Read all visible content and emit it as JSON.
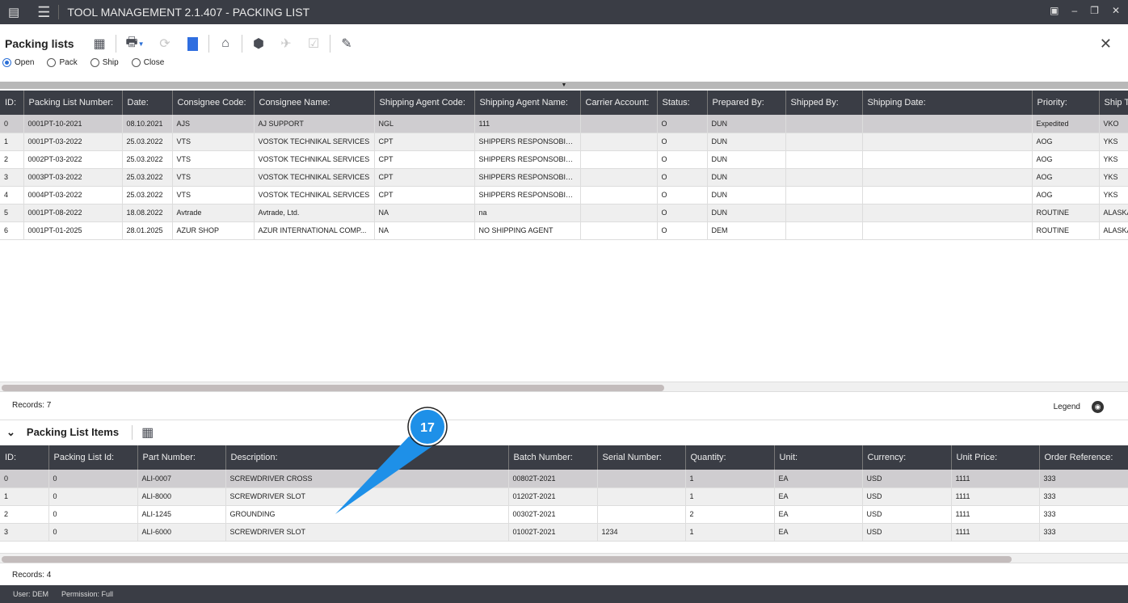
{
  "app": {
    "title": "TOOL MANAGEMENT 2.1.407 - PACKING LIST"
  },
  "toolbar": {
    "title": "Packing lists",
    "icons": [
      "grid-export-icon",
      "printer-icon",
      "refresh-icon",
      "document-icon",
      "warehouse-icon",
      "box-icon",
      "plane-icon",
      "approve-doc-icon",
      "clipboard-edit-icon"
    ]
  },
  "filters": [
    {
      "label": "Open",
      "selected": true
    },
    {
      "label": "Pack",
      "selected": false
    },
    {
      "label": "Ship",
      "selected": false
    },
    {
      "label": "Close",
      "selected": false
    }
  ],
  "packing_lists": {
    "columns": [
      "ID:",
      "Packing List Number:",
      "Date:",
      "Consignee Code:",
      "Consignee Name:",
      "Shipping Agent Code:",
      "Shipping Agent Name:",
      "Carrier Account:",
      "Status:",
      "Prepared By:",
      "Shipped By:",
      "Shipping Date:",
      "Priority:",
      "Ship To:"
    ],
    "rows": [
      [
        "0",
        "0001PT-10-2021",
        "08.10.2021",
        "AJS",
        "AJ SUPPORT",
        "NGL",
        "111",
        "",
        "O",
        "DUN",
        "",
        "",
        "Expedited",
        "VKO"
      ],
      [
        "1",
        "0001PT-03-2022",
        "25.03.2022",
        "VTS",
        "VOSTOK TECHNIKAL SERVICES",
        "CPT",
        "SHIPPERS RESPONSOBILITY",
        "",
        "O",
        "DUN",
        "",
        "",
        "AOG",
        "YKS"
      ],
      [
        "2",
        "0002PT-03-2022",
        "25.03.2022",
        "VTS",
        "VOSTOK TECHNIKAL SERVICES",
        "CPT",
        "SHIPPERS RESPONSOBILITY",
        "",
        "O",
        "DUN",
        "",
        "",
        "AOG",
        "YKS"
      ],
      [
        "3",
        "0003PT-03-2022",
        "25.03.2022",
        "VTS",
        "VOSTOK TECHNIKAL SERVICES",
        "CPT",
        "SHIPPERS RESPONSOBILITY",
        "",
        "O",
        "DUN",
        "",
        "",
        "AOG",
        "YKS"
      ],
      [
        "4",
        "0004PT-03-2022",
        "25.03.2022",
        "VTS",
        "VOSTOK TECHNIKAL SERVICES",
        "CPT",
        "SHIPPERS RESPONSOBILITY",
        "",
        "O",
        "DUN",
        "",
        "",
        "AOG",
        "YKS"
      ],
      [
        "5",
        "0001PT-08-2022",
        "18.08.2022",
        "Avtrade",
        "Avtrade, Ltd.",
        "NA",
        "na",
        "",
        "O",
        "DUN",
        "",
        "",
        "ROUTINE",
        "ALASKA"
      ],
      [
        "6",
        "0001PT-01-2025",
        "28.01.2025",
        "AZUR SHOP",
        "AZUR INTERNATIONAL COMP...",
        "NA",
        "NO SHIPPING AGENT",
        "",
        "O",
        "DEM",
        "",
        "",
        "ROUTINE",
        "ALASKA"
      ]
    ],
    "records": "Records: 7",
    "legend": "Legend"
  },
  "items": {
    "title": "Packing List Items",
    "columns": [
      "ID:",
      "Packing List Id:",
      "Part Number:",
      "Description:",
      "Batch Number:",
      "Serial Number:",
      "Quantity:",
      "Unit:",
      "Currency:",
      "Unit Price:",
      "Order Reference:"
    ],
    "rows": [
      [
        "0",
        "0",
        "ALI-0007",
        "SCREWDRIVER CROSS",
        "00802T-2021",
        "",
        "1",
        "EA",
        "USD",
        "1111",
        "333"
      ],
      [
        "1",
        "0",
        "ALI-8000",
        "SCREWDRIVER SLOT",
        "01202T-2021",
        "",
        "1",
        "EA",
        "USD",
        "1111",
        "333"
      ],
      [
        "2",
        "0",
        "ALI-1245",
        "GROUNDING",
        "00302T-2021",
        "",
        "2",
        "EA",
        "USD",
        "1111",
        "333"
      ],
      [
        "3",
        "0",
        "ALI-6000",
        "SCREWDRIVER SLOT",
        "01002T-2021",
        "1234",
        "1",
        "EA",
        "USD",
        "1111",
        "333"
      ]
    ],
    "records": "Records: 4"
  },
  "callout": {
    "label": "17",
    "color": "#1e90e8"
  },
  "status": {
    "user": "User: DEM",
    "permission": "Permission: Full"
  }
}
